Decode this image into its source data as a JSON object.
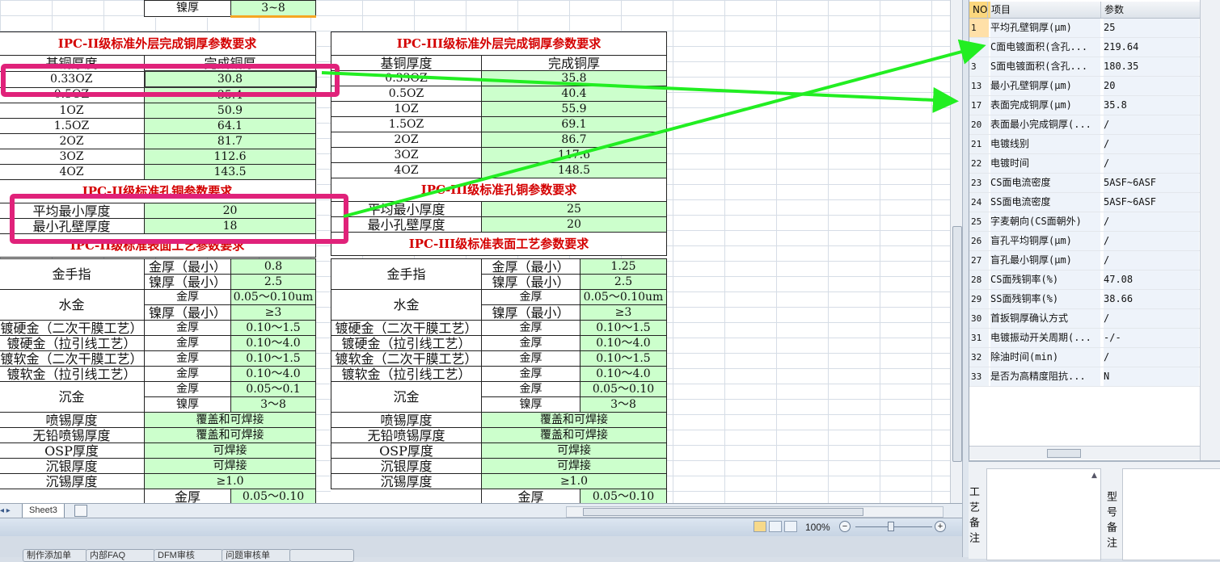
{
  "top_fragment": {
    "label": "镍厚",
    "value": "3~8"
  },
  "sheet": {
    "ipc2_copper": {
      "title": "IPC-II级标准外层完成铜厚参数要求",
      "h1": "基铜厚度",
      "h2": "完成铜厚",
      "rows": [
        [
          "0.33OZ",
          "30.8"
        ],
        [
          "0.5OZ",
          "35.4"
        ],
        [
          "1OZ",
          "50.9"
        ],
        [
          "1.5OZ",
          "64.1"
        ],
        [
          "2OZ",
          "81.7"
        ],
        [
          "3OZ",
          "112.6"
        ],
        [
          "4OZ",
          "143.5"
        ]
      ]
    },
    "ipc3_copper": {
      "title": "IPC-III级标准外层完成铜厚参数要求",
      "h1": "基铜厚度",
      "h2": "完成铜厚",
      "rows": [
        [
          "0.33OZ",
          "35.8"
        ],
        [
          "0.5OZ",
          "40.4"
        ],
        [
          "1OZ",
          "55.9"
        ],
        [
          "1.5OZ",
          "69.1"
        ],
        [
          "2OZ",
          "86.7"
        ],
        [
          "3OZ",
          "117.6"
        ],
        [
          "4OZ",
          "148.5"
        ]
      ]
    },
    "ipc2_hole": {
      "title": "IPC-II级标准孔铜参数要求",
      "rows": [
        [
          "平均最小厚度",
          "20"
        ],
        [
          "最小孔壁厚度",
          "18"
        ]
      ]
    },
    "ipc3_hole": {
      "title": "IPC-III级标准孔铜参数要求",
      "rows": [
        [
          "平均最小厚度",
          "25"
        ],
        [
          "最小孔壁厚度",
          "20"
        ]
      ]
    },
    "ipc2_surface": {
      "title": "IPC-II级标准表面工艺参数要求",
      "gold_finger": "金手指",
      "gf_thick_min": "金厚（最小）",
      "gf_thick_val": "0.8",
      "gf_ni_min": "镍厚（最小）",
      "gf_ni_val": "2.5",
      "water_gold": "水金",
      "wg_gold": "金厚",
      "wg_gold_val": "0.05～0.10um",
      "wg_ni": "镍厚（最小）",
      "wg_ni_val": "≥3",
      "hard_dry": "镀硬金（二次干膜工艺）",
      "hard_pull": "镀硬金（拉引线工艺）",
      "soft_dry": "镀软金（二次干膜工艺）",
      "soft_pull": "镀软金（拉引线工艺）",
      "gold": "金厚",
      "hard_dry_val": "0.10～1.5",
      "hard_pull_val": "0.10～4.0",
      "soft_dry_val": "0.10～1.5",
      "soft_pull_val": "0.10～4.0",
      "enig": "沉金",
      "enig_gold": "金厚",
      "enig_gold_val": "0.05～0.1",
      "enig_ni": "镍厚",
      "enig_ni_val": "3～8",
      "hasl": "喷锡厚度",
      "hasl_val": "覆盖和可焊接",
      "lf_hasl": "无铅喷锡厚度",
      "lf_hasl_val": "覆盖和可焊接",
      "osp": "OSP厚度",
      "osp_val": "可焊接",
      "silver": "沉银厚度",
      "silver_val": "可焊接",
      "tin": "沉锡厚度",
      "tin_val": "≥1.0",
      "last_label": "金厚",
      "last_val": "0.05～0.10"
    },
    "ipc3_surface": {
      "title": "IPC-III级标准表面工艺参数要求",
      "gold_finger": "金手指",
      "gf_thick_min": "金厚（最小）",
      "gf_thick_val": "1.25",
      "gf_ni_min": "镍厚（最小）",
      "gf_ni_val": "2.5",
      "water_gold": "水金",
      "wg_gold": "金厚",
      "wg_gold_val": "0.05～0.10um",
      "wg_ni": "镍厚（最小）",
      "wg_ni_val": "≥3",
      "hard_dry": "镀硬金（二次干膜工艺）",
      "hard_pull": "镀硬金（拉引线工艺）",
      "soft_dry": "镀软金（二次干膜工艺）",
      "soft_pull": "镀软金（拉引线工艺）",
      "gold": "金厚",
      "hard_dry_val": "0.10～1.5",
      "hard_pull_val": "0.10～4.0",
      "soft_dry_val": "0.10～1.5",
      "soft_pull_val": "0.10～4.0",
      "enig": "沉金",
      "enig_gold": "金厚",
      "enig_gold_val": "0.05～0.10",
      "enig_ni": "镍厚",
      "enig_ni_val": "3～8",
      "hasl": "喷锡厚度",
      "hasl_val": "覆盖和可焊接",
      "lf_hasl": "无铅喷锡厚度",
      "lf_hasl_val": "覆盖和可焊接",
      "osp": "OSP厚度",
      "osp_val": "可焊接",
      "silver": "沉银厚度",
      "silver_val": "可焊接",
      "tin": "沉锡厚度",
      "tin_val": "≥1.0",
      "last_label": "金厚",
      "last_val": "0.05～0.10"
    }
  },
  "tabs": {
    "sheet3": "Sheet3",
    "nav": "◂ ▸"
  },
  "status": {
    "zoom": "100%",
    "minus": "−",
    "plus": "+"
  },
  "bottom_buttons": [
    "制作添加单",
    "内部FAQ",
    "DFM审核",
    "问题审核单",
    ""
  ],
  "param_panel": {
    "headers": {
      "no": "NO",
      "item": "项目",
      "param": "参数"
    },
    "rows": [
      {
        "no": "1",
        "name": "平均孔壁铜厚(μm)",
        "val": "25"
      },
      {
        "no": "2",
        "name": "C面电镀面积(含孔...",
        "val": "219.64"
      },
      {
        "no": "3",
        "name": "S面电镀面积(含孔...",
        "val": "180.35"
      },
      {
        "no": "13",
        "name": "最小孔壁铜厚(μm)",
        "val": "20"
      },
      {
        "no": "17",
        "name": "表面完成铜厚(μm)",
        "val": "35.8"
      },
      {
        "no": "20",
        "name": "表面最小完成铜厚(...",
        "val": "/"
      },
      {
        "no": "21",
        "name": "电镀线别",
        "val": "/"
      },
      {
        "no": "22",
        "name": "电镀时间",
        "val": "/"
      },
      {
        "no": "23",
        "name": "CS面电流密度",
        "val": "5ASF~6ASF"
      },
      {
        "no": "24",
        "name": "SS面电流密度",
        "val": "5ASF~6ASF"
      },
      {
        "no": "25",
        "name": "字麦朝向(CS面朝外)",
        "val": "/"
      },
      {
        "no": "26",
        "name": "盲孔平均铜厚(μm)",
        "val": "/"
      },
      {
        "no": "27",
        "name": "盲孔最小铜厚(μm)",
        "val": "/"
      },
      {
        "no": "28",
        "name": "CS面残铜率(%)",
        "val": "47.08"
      },
      {
        "no": "29",
        "name": "SS面残铜率(%)",
        "val": "38.66"
      },
      {
        "no": "30",
        "name": "首扳铜厚确认方式",
        "val": "/"
      },
      {
        "no": "31",
        "name": "电镀振动开关周期(...",
        "val": "-/-"
      },
      {
        "no": "32",
        "name": "除油时间(min)",
        "val": "/"
      },
      {
        "no": "33",
        "name": "是否为高精度阻抗...",
        "val": "N"
      }
    ]
  },
  "bottom_panel": {
    "process_note": "工艺备注",
    "model_note": "型号备注"
  },
  "colors": {
    "highlight": "#e0227a",
    "arrow": "#22ee22",
    "title_red": "#d40000",
    "cell_green": "#ccffcc"
  }
}
